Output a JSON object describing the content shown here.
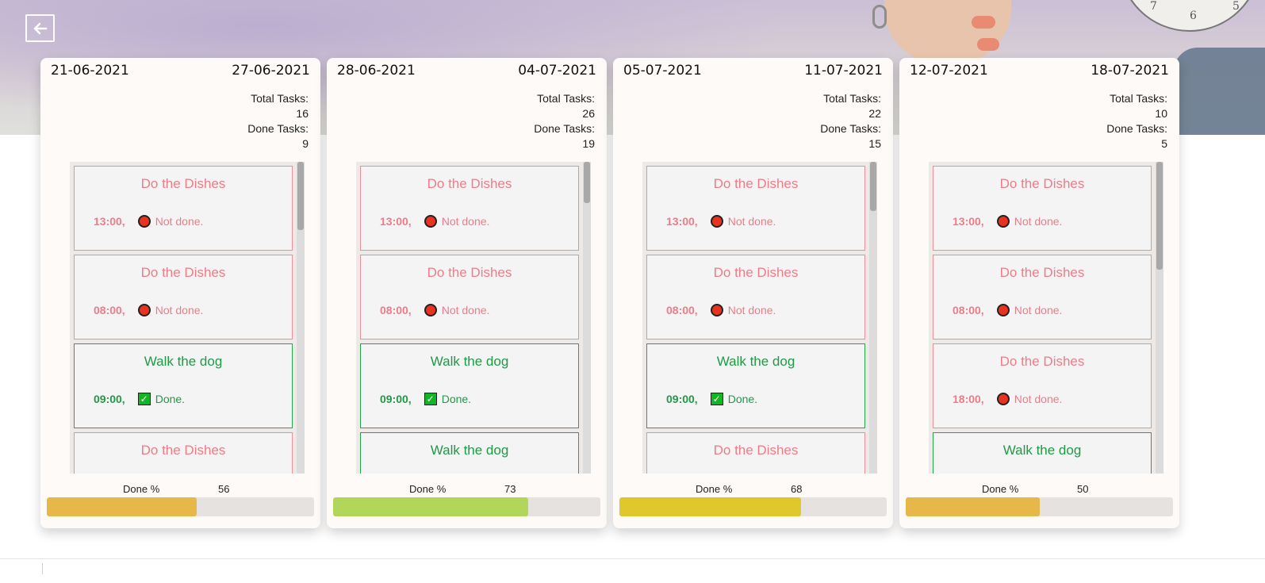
{
  "back_button": {
    "icon": "arrow-left-icon"
  },
  "background": {
    "clock_numbers": [
      "7",
      "6",
      "5"
    ]
  },
  "labels": {
    "total_tasks": "Total Tasks:",
    "done_tasks": "Done Tasks:",
    "done_percent": "Done %"
  },
  "colors": {
    "not_done": "#ee7c88",
    "done": "#1f9a45",
    "progress_56": "#e6b84a",
    "progress_73": "#b2d65a",
    "progress_68": "#dfc72c",
    "progress_50": "#e6b84a"
  },
  "weeks": [
    {
      "start": "21-06-2021",
      "end": "27-06-2021",
      "total": "16",
      "done": "9",
      "percent": "56",
      "tasks": [
        {
          "title": "Do the Dishes",
          "time": "13:00,",
          "status": "Not done.",
          "done": false
        },
        {
          "title": "Do the Dishes",
          "time": "08:00,",
          "status": "Not done.",
          "done": false
        },
        {
          "title": "Walk the dog",
          "time": "09:00,",
          "status": "Done.",
          "done": true
        },
        {
          "title": "Do the Dishes",
          "time": "",
          "status": "",
          "done": false
        }
      ]
    },
    {
      "start": "28-06-2021",
      "end": "04-07-2021",
      "total": "26",
      "done": "19",
      "percent": "73",
      "tasks": [
        {
          "title": "Do the Dishes",
          "time": "13:00,",
          "status": "Not done.",
          "done": false
        },
        {
          "title": "Do the Dishes",
          "time": "08:00,",
          "status": "Not done.",
          "done": false
        },
        {
          "title": "Walk the dog",
          "time": "09:00,",
          "status": "Done.",
          "done": true
        },
        {
          "title": "Walk the dog",
          "time": "",
          "status": "",
          "done": true
        }
      ]
    },
    {
      "start": "05-07-2021",
      "end": "11-07-2021",
      "total": "22",
      "done": "15",
      "percent": "68",
      "tasks": [
        {
          "title": "Do the Dishes",
          "time": "13:00,",
          "status": "Not done.",
          "done": false
        },
        {
          "title": "Do the Dishes",
          "time": "08:00,",
          "status": "Not done.",
          "done": false
        },
        {
          "title": "Walk the dog",
          "time": "09:00,",
          "status": "Done.",
          "done": true
        },
        {
          "title": "Do the Dishes",
          "time": "",
          "status": "",
          "done": false
        }
      ]
    },
    {
      "start": "12-07-2021",
      "end": "18-07-2021",
      "total": "10",
      "done": "5",
      "percent": "50",
      "tasks": [
        {
          "title": "Do the Dishes",
          "time": "13:00,",
          "status": "Not done.",
          "done": false
        },
        {
          "title": "Do the Dishes",
          "time": "08:00,",
          "status": "Not done.",
          "done": false
        },
        {
          "title": "Do the Dishes",
          "time": "18:00,",
          "status": "Not done.",
          "done": false
        },
        {
          "title": "Walk the dog",
          "time": "",
          "status": "",
          "done": true
        }
      ]
    }
  ]
}
